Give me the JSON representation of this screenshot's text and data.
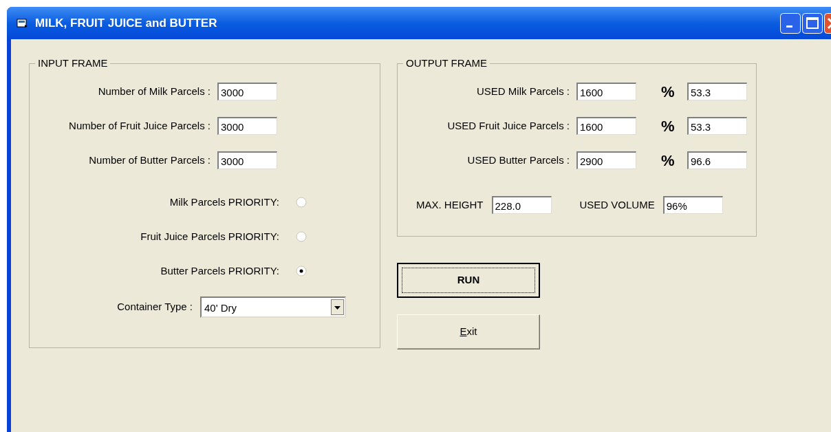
{
  "window": {
    "title": "MILK, FRUIT JUICE and BUTTER"
  },
  "input_frame": {
    "title": "INPUT FRAME",
    "quantities": [
      {
        "label": "Number of Milk Parcels :",
        "value": "3000"
      },
      {
        "label": "Number of Fruit Juice Parcels :",
        "value": "3000"
      },
      {
        "label": "Number of Butter Parcels :",
        "value": "3000"
      }
    ],
    "priorities": [
      {
        "label": "Milk Parcels PRIORITY:",
        "selected": false
      },
      {
        "label": "Fruit Juice Parcels PRIORITY:",
        "selected": false
      },
      {
        "label": "Butter Parcels PRIORITY:",
        "selected": true
      }
    ],
    "container": {
      "label": "Container Type :",
      "value": "40' Dry"
    }
  },
  "output_frame": {
    "title": "OUTPUT FRAME",
    "used": [
      {
        "label": "USED Milk Parcels :",
        "value": "1600",
        "percent_sign": "%",
        "percent": "53.3"
      },
      {
        "label": "USED Fruit Juice Parcels :",
        "value": "1600",
        "percent_sign": "%",
        "percent": "53.3"
      },
      {
        "label": "USED Butter Parcels :",
        "value": "2900",
        "percent_sign": "%",
        "percent": "96.6"
      }
    ],
    "max_height": {
      "label": "MAX. HEIGHT",
      "value": "228.0"
    },
    "used_volume": {
      "label": "USED VOLUME",
      "value": "96%"
    }
  },
  "buttons": [
    {
      "label": "RUN",
      "default": true,
      "mnemonic_first": false
    },
    {
      "label": "Exit",
      "default": false,
      "mnemonic_first": true
    }
  ]
}
